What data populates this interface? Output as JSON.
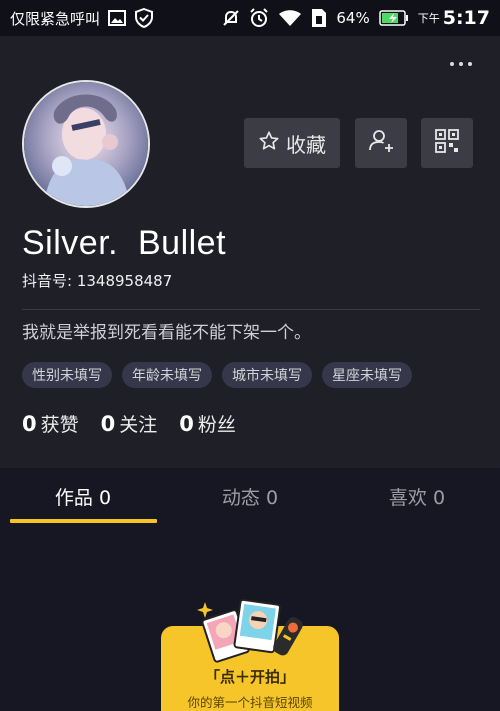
{
  "status_bar": {
    "carrier_text": "仅限紧急呼叫",
    "battery": "64%",
    "time_prefix": "下午",
    "time": "5:17",
    "icons": [
      "image-icon",
      "shield-check-icon",
      "mute-icon",
      "alarm-icon",
      "wifi-icon",
      "sim-icon",
      "battery-charging-icon"
    ]
  },
  "profile": {
    "name": "Silver.  Bullet",
    "douyin_id": "抖音号: 1348958487",
    "bio": "我就是举报到死看看能不能下架一个。",
    "tags": [
      "性别未填写",
      "年龄未填写",
      "城市未填写",
      "星座未填写"
    ]
  },
  "actions": {
    "collect_label": "收藏",
    "collect_icon": "star-outline-icon",
    "follow_icon": "add-user-icon",
    "qr_icon": "qr-code-icon",
    "more_icon": "more-horizontal-icon"
  },
  "stats": [
    {
      "value": "0",
      "label": "获赞"
    },
    {
      "value": "0",
      "label": "关注"
    },
    {
      "value": "0",
      "label": "粉丝"
    }
  ],
  "tabs": [
    {
      "label": "作品 0",
      "active": true
    },
    {
      "label": "动态 0",
      "active": false
    },
    {
      "label": "喜欢 0",
      "active": false
    }
  ],
  "empty_state": {
    "title": "「点＋开拍」",
    "subtitle": "你的第一个抖音短视频"
  },
  "colors": {
    "background": "#161722",
    "header_background": "#1e1f27",
    "accent": "#f5c521",
    "button": "#3b3c46",
    "tag": "#36374a"
  }
}
